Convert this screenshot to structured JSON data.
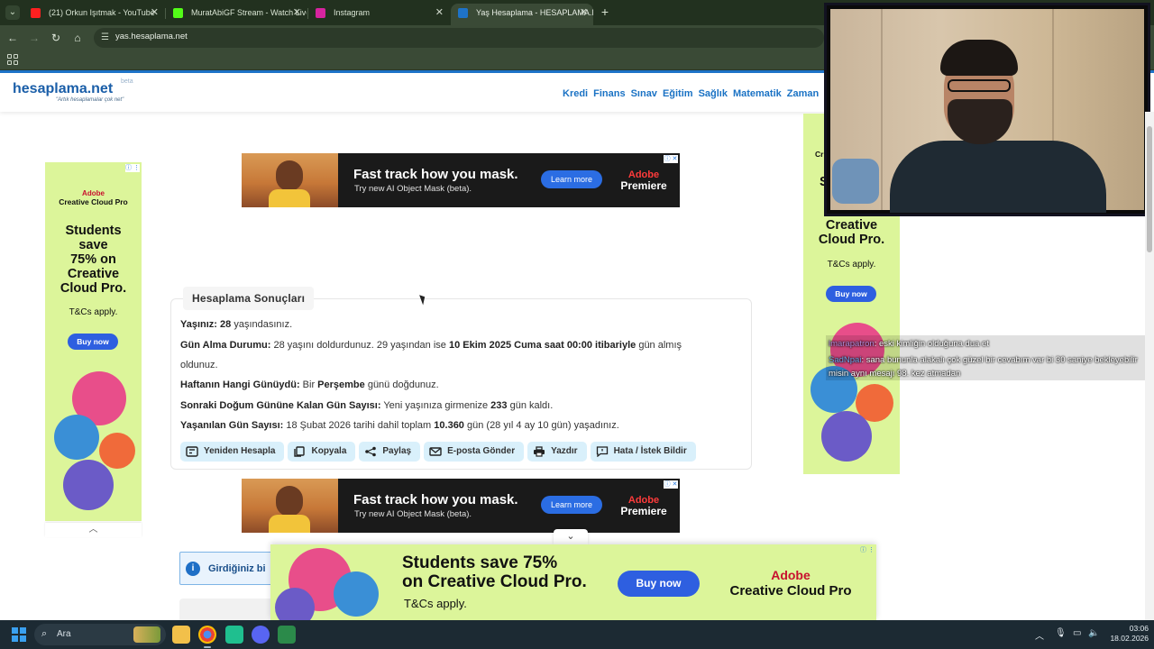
{
  "browser": {
    "tabs": [
      {
        "title": "(21) Orkun Işıtmak - YouTube",
        "favicon_color": "#ff2020"
      },
      {
        "title": "MuratAbiGF Stream - Watch Live",
        "favicon_color": "#53fc18"
      },
      {
        "title": "Instagram",
        "favicon_color": "#d6249f"
      },
      {
        "title": "Yaş Hesaplama - HESAPLAMA.NET",
        "favicon_color": "#1e73c8"
      }
    ],
    "url": "yas.hesaplama.net"
  },
  "site": {
    "logo": "hesaplama.net",
    "logo_beta": "beta",
    "tagline": "\"Artık hesaplamalar çok net\"",
    "nav": [
      "Kredi",
      "Finans",
      "Sınav",
      "Eğitim",
      "Sağlık",
      "Matematik",
      "Zaman"
    ]
  },
  "ads": {
    "banner": {
      "headline": "Fast track how you mask.",
      "sub": "Try new AI Object Mask (beta).",
      "cta": "Learn more",
      "brand_top": "Adobe",
      "brand_bottom": "Premiere"
    },
    "side_left": {
      "adobe": "Adobe",
      "product": "Creative Cloud Pro",
      "line1": "Students",
      "line2": "save",
      "line3": "75% on",
      "line4": "Creative",
      "line5": "Cloud Pro.",
      "tcs": "T&Cs apply.",
      "cta": "Buy now"
    },
    "side_right": {
      "top_fragment": "Cr",
      "top_fragment2": "S",
      "line4": "Creative",
      "line5": "Cloud Pro.",
      "tcs": "T&Cs apply.",
      "cta": "Buy now"
    },
    "sticky": {
      "line1": "Students save 75%",
      "line2": "on Creative Cloud Pro.",
      "tcs": "T&Cs apply.",
      "cta": "Buy now",
      "adobe": "Adobe",
      "product": "Creative Cloud Pro"
    }
  },
  "results": {
    "title": "Hesaplama Sonuçları",
    "rows": [
      {
        "label": "Yaşınız:",
        "value_bold": "28",
        "rest": " yaşındasınız."
      },
      {
        "label": "Gün Alma Durumu:",
        "text1": " 28 yaşını doldurdunuz. 29 yaşından ise ",
        "bold": "10 Ekim 2025 Cuma saat 00:00 itibariyle",
        "text2": " gün almış",
        "wrap": "oldunuz."
      },
      {
        "label": "Haftanın Hangi Günüydü:",
        "text1": " Bir ",
        "bold": "Perşembe",
        "text2": " günü doğdunuz."
      },
      {
        "label": "Sonraki Doğum Gününe Kalan Gün Sayısı:",
        "text1": " Yeni yaşınıza girmenize ",
        "bold": "233",
        "text2": " gün kaldı."
      },
      {
        "label": "Yaşanılan Gün Sayısı:",
        "text1": " 18 Şubat 2026 tarihi dahil toplam ",
        "bold": "10.360",
        "text2": " gün (28 yıl 4 ay 10 gün) yaşadınız."
      }
    ],
    "actions": [
      "Yeniden Hesapla",
      "Kopyala",
      "Paylaş",
      "E-posta Gönder",
      "Yazdır",
      "Hata / İstek Bildir"
    ],
    "info_text": "Girdiğiniz bi"
  },
  "chat": [
    {
      "user": "lmarapatron",
      "message": ": eski kimliğin olduğuna dua et"
    },
    {
      "user": "SadNpai",
      "message": ": sana bununla alakalı çok güzel bir cevabım var bi 30 saniye bekleyebilir misin aynı mesajı 98. kez atmadan"
    }
  ],
  "taskbar": {
    "search_placeholder": "Ara",
    "time": "03:06",
    "date": "18.02.2026"
  }
}
